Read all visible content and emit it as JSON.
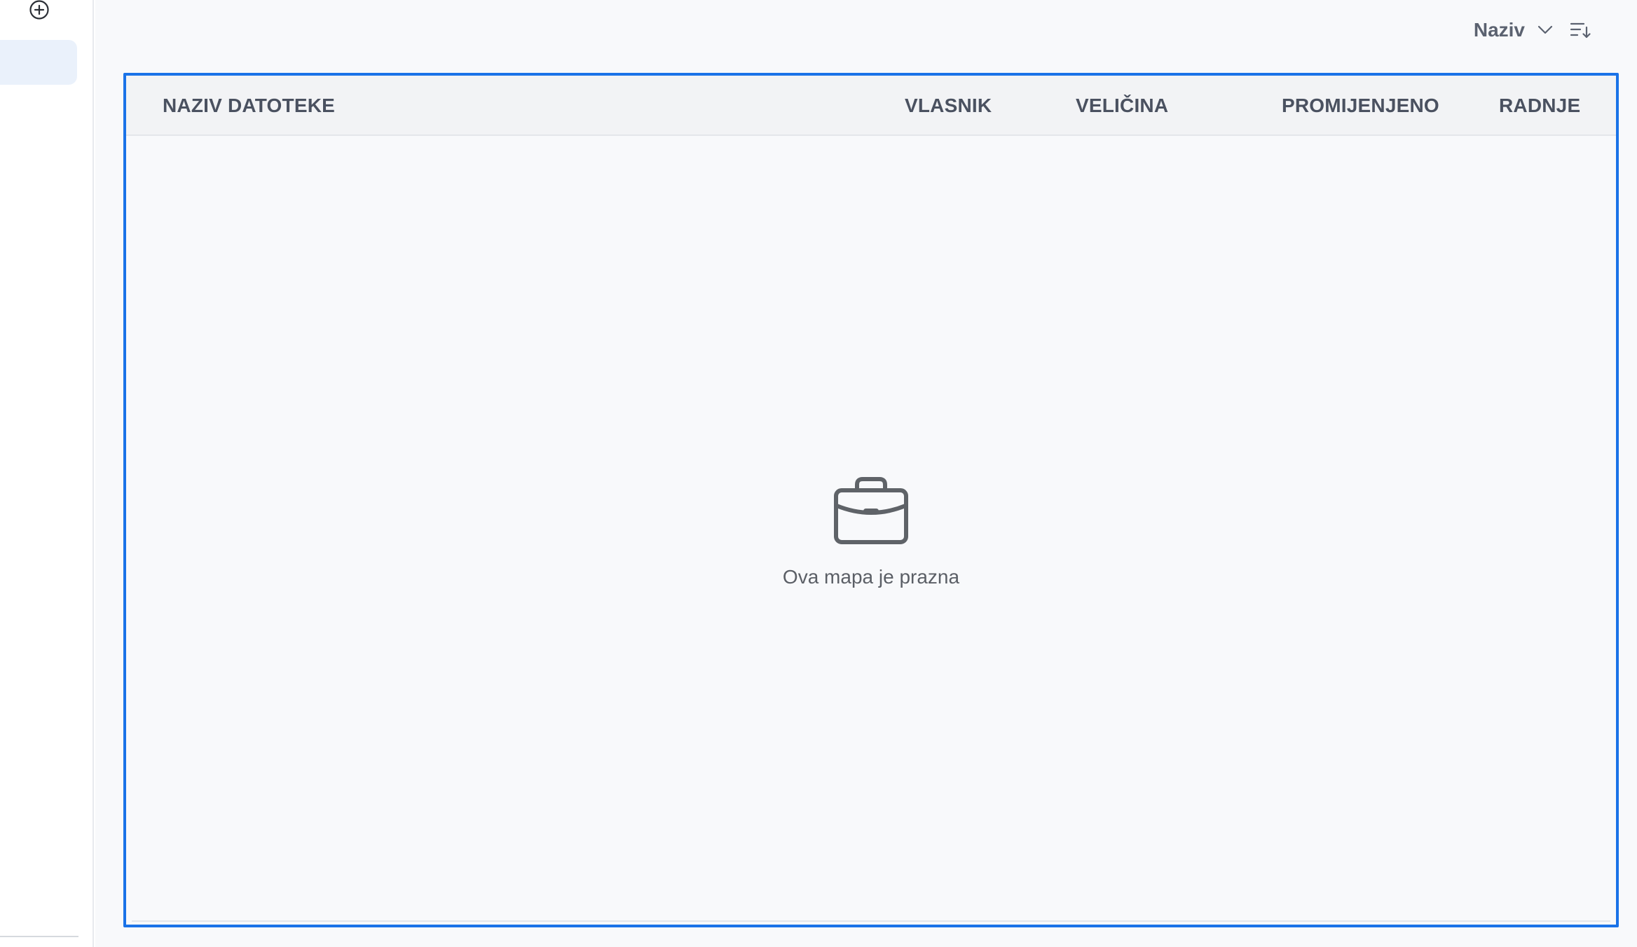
{
  "sidebar": {
    "add_icon": "plus-circle-icon"
  },
  "sort": {
    "selected": "Naziv",
    "dropdown_icon": "chevron-down-icon",
    "direction_icon": "sort-descending-icon"
  },
  "table": {
    "columns": [
      "NAZIV DATOTEKE",
      "VLASNIK",
      "VELIČINA",
      "PROMIJENJENO",
      "RADNJE"
    ],
    "empty_message": "Ova mapa je prazna",
    "empty_icon": "briefcase-icon"
  },
  "colors": {
    "accent": "#1a73e8",
    "sidebar_active": "#eaf1fb",
    "header_bg": "#f2f3f5",
    "icon": "#5f6368"
  }
}
